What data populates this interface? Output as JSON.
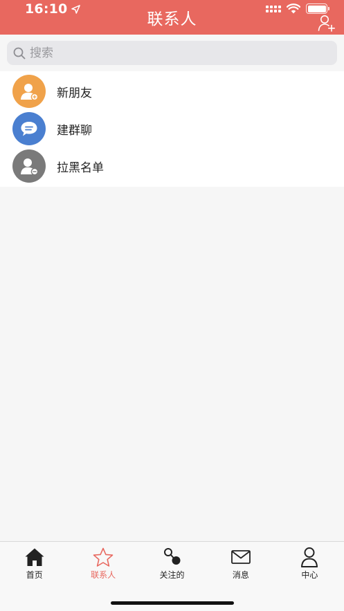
{
  "status_bar": {
    "time": "16:10"
  },
  "header": {
    "title": "联系人"
  },
  "search": {
    "placeholder": "搜索"
  },
  "list": {
    "items": [
      {
        "label": "新朋友",
        "icon": "add-friend-icon",
        "color": "#f0a24a"
      },
      {
        "label": "建群聊",
        "icon": "chat-bubble-icon",
        "color": "#4a7fd0"
      },
      {
        "label": "拉黑名单",
        "icon": "block-user-icon",
        "color": "#7a7a7a"
      }
    ]
  },
  "tabbar": {
    "tabs": [
      {
        "label": "首页",
        "icon": "home-icon"
      },
      {
        "label": "联系人",
        "icon": "star-icon",
        "active": true
      },
      {
        "label": "关注的",
        "icon": "follow-icon"
      },
      {
        "label": "消息",
        "icon": "mail-icon"
      },
      {
        "label": "中心",
        "icon": "person-icon"
      }
    ]
  },
  "colors": {
    "accent": "#e8685f",
    "background": "#f6f6f6"
  }
}
